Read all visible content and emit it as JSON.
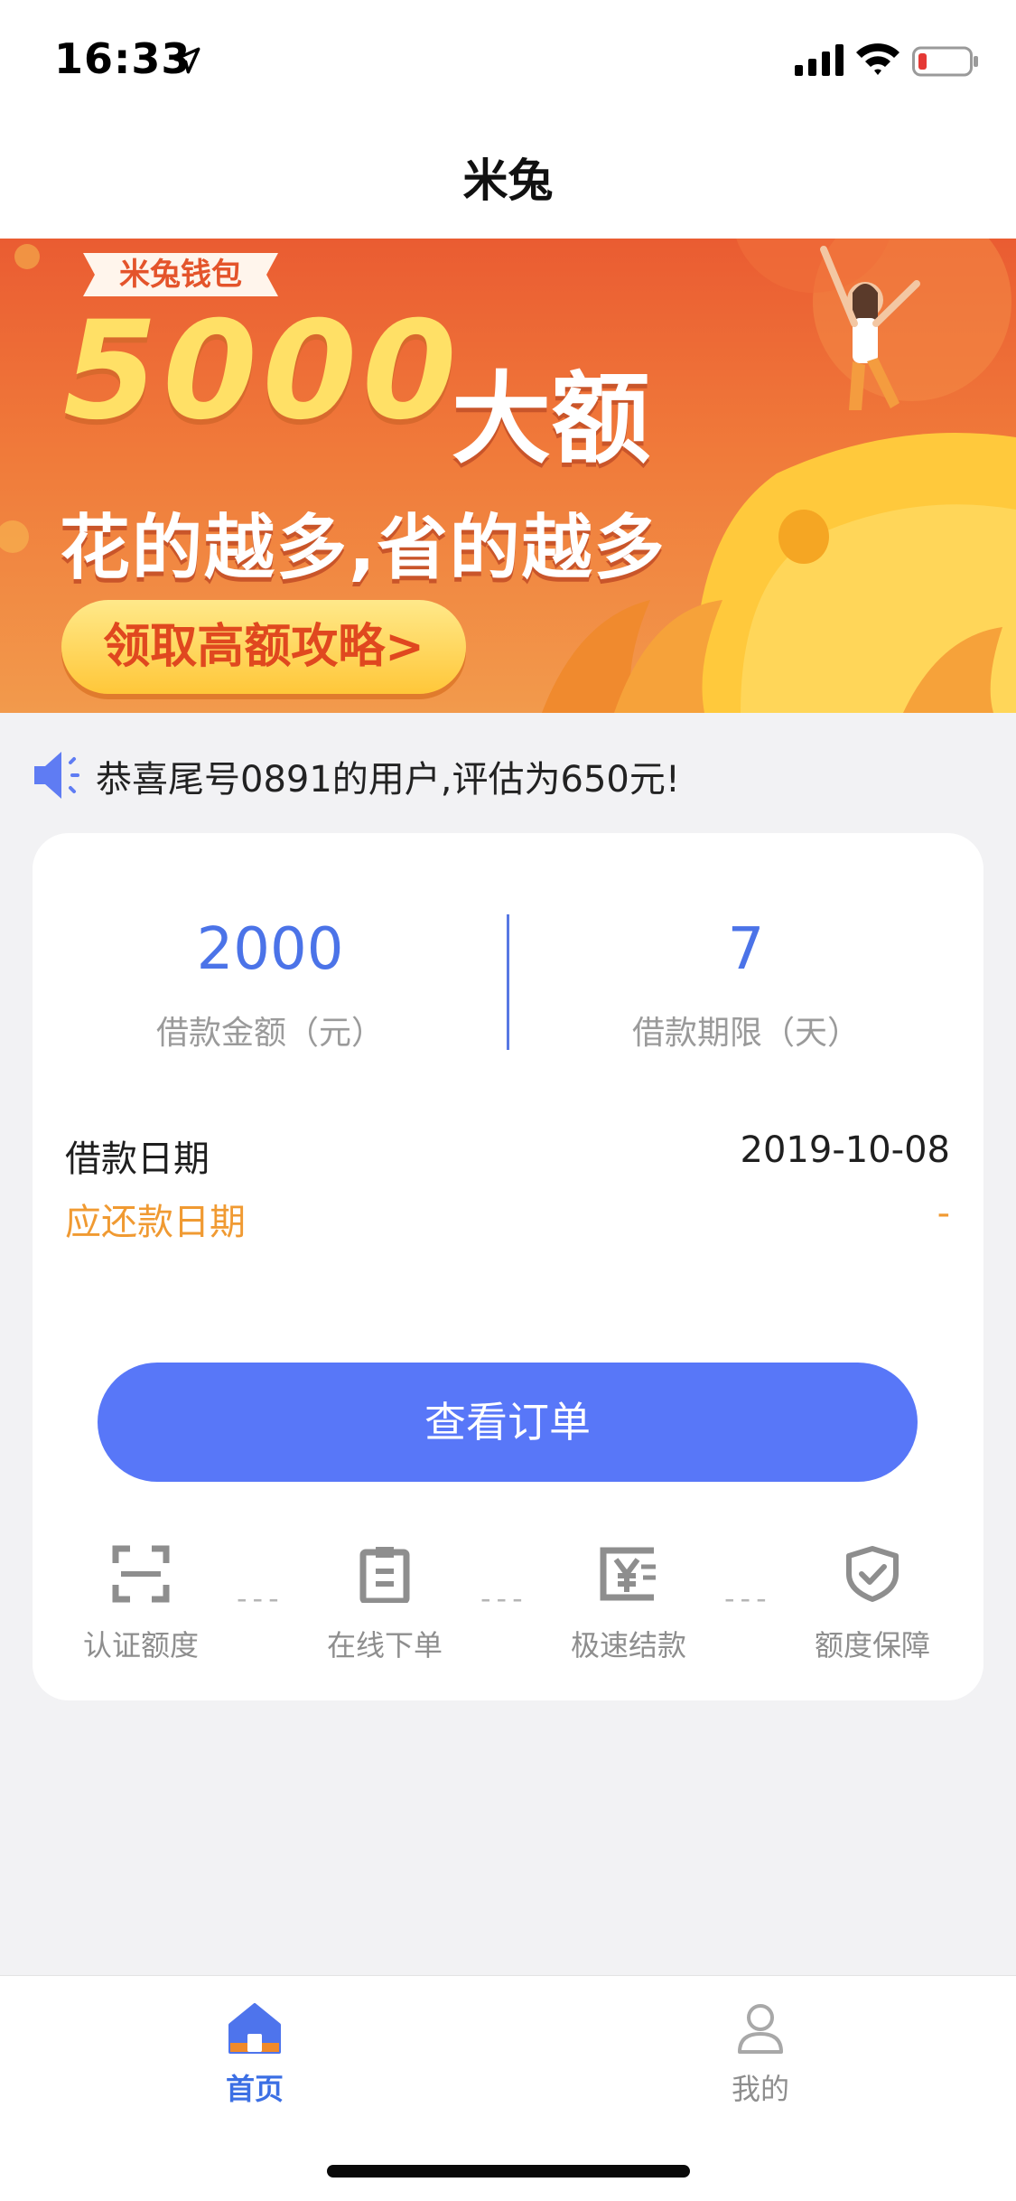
{
  "status_bar": {
    "time": "16:33"
  },
  "nav": {
    "title": "米兔"
  },
  "banner": {
    "brand_tag": "米兔钱包",
    "amount": "5000",
    "amount_label": "大额",
    "slogan": "花的越多,省的越多",
    "cta": "领取高额攻略>"
  },
  "notice": {
    "text": "恭喜尾号0891的用户,评估为650元!"
  },
  "loan": {
    "amount": {
      "value": "2000",
      "label": "借款金额（元）"
    },
    "term": {
      "value": "7",
      "label": "借款期限（天）"
    },
    "loan_date": {
      "label": "借款日期",
      "value": "2019-10-08"
    },
    "repay_date": {
      "label": "应还款日期",
      "value": "-"
    },
    "button": "查看订单"
  },
  "steps": [
    {
      "label": "认证额度",
      "icon": "scan-icon"
    },
    {
      "label": "在线下单",
      "icon": "clipboard-icon"
    },
    {
      "label": "极速结款",
      "icon": "yen-speed-icon"
    },
    {
      "label": "额度保障",
      "icon": "shield-check-icon"
    }
  ],
  "step_separator": "---",
  "tabs": [
    {
      "label": "首页",
      "icon": "home-icon",
      "active": true
    },
    {
      "label": "我的",
      "icon": "user-icon",
      "active": false
    }
  ],
  "colors": {
    "accent": "#5877f8",
    "stat_blue": "#4b73e8",
    "warning_orange": "#f09a32",
    "banner_orange": "#ea5c32"
  }
}
